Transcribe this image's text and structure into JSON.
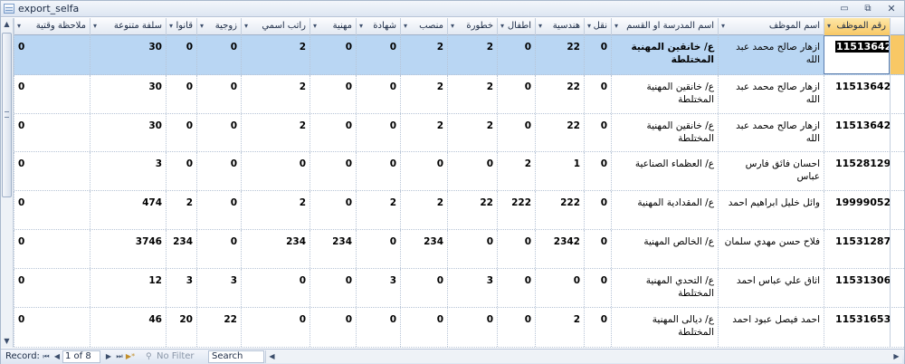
{
  "window": {
    "title": "export_selfa",
    "minimize_glyph": "▭",
    "restore_glyph": "⧉",
    "close_glyph": "✕"
  },
  "columns": [
    {
      "key": "notes",
      "label": "ملاحظة وقتية"
    },
    {
      "key": "advance",
      "label": "سلفة متنوعة"
    },
    {
      "key": "law",
      "label": "قانوا"
    },
    {
      "key": "spouse",
      "label": "زوجية"
    },
    {
      "key": "nominal_salary",
      "label": "راتب اسمي"
    },
    {
      "key": "professional",
      "label": "مهنية"
    },
    {
      "key": "certificate",
      "label": "شهادة"
    },
    {
      "key": "position",
      "label": "منصب"
    },
    {
      "key": "danger",
      "label": "خطورة"
    },
    {
      "key": "children",
      "label": "اطفال"
    },
    {
      "key": "engineering",
      "label": "هندسية"
    },
    {
      "key": "transport",
      "label": "نقل"
    },
    {
      "key": "school",
      "label": "اسم المدرسة او القسم"
    },
    {
      "key": "name",
      "label": "اسم الموظف"
    },
    {
      "key": "emp_id",
      "label": "رقم الموظف"
    }
  ],
  "rows": [
    {
      "emp_id": "115136427",
      "name": "ازهار صالح محمد عبد الله",
      "school": "ع/ خانقين المهنية المختلطة",
      "transport": "0",
      "engineering": "22",
      "children": "0",
      "danger": "2",
      "position": "2",
      "certificate": "0",
      "professional": "0",
      "nominal_salary": "2",
      "spouse": "0",
      "law": "0",
      "advance": "30",
      "notes": "0"
    },
    {
      "emp_id": "115136427",
      "name": "ازهار صالح محمد عبد الله",
      "school": "ع/ خانقين المهنية المختلطة",
      "transport": "0",
      "engineering": "22",
      "children": "0",
      "danger": "2",
      "position": "2",
      "certificate": "0",
      "professional": "0",
      "nominal_salary": "2",
      "spouse": "0",
      "law": "0",
      "advance": "30",
      "notes": "0"
    },
    {
      "emp_id": "115136427",
      "name": "ازهار صالح محمد عبد الله",
      "school": "ع/ خانقين المهنية المختلطة",
      "transport": "0",
      "engineering": "22",
      "children": "0",
      "danger": "2",
      "position": "2",
      "certificate": "0",
      "professional": "0",
      "nominal_salary": "2",
      "spouse": "0",
      "law": "0",
      "advance": "30",
      "notes": "0"
    },
    {
      "emp_id": "115281293",
      "name": "احسان فائق فارس عباس",
      "school": "ع/ العظماء الصناعية",
      "transport": "0",
      "engineering": "1",
      "children": "2",
      "danger": "0",
      "position": "0",
      "certificate": "0",
      "professional": "0",
      "nominal_salary": "0",
      "spouse": "0",
      "law": "0",
      "advance": "3",
      "notes": "0"
    },
    {
      "emp_id": "19999052",
      "name": "وائل خليل ابراهيم احمد",
      "school": "ع/ المقدادية المهنية",
      "transport": "0",
      "engineering": "222",
      "children": "222",
      "danger": "22",
      "position": "2",
      "certificate": "2",
      "professional": "0",
      "nominal_salary": "2",
      "spouse": "0",
      "law": "2",
      "advance": "474",
      "notes": "0"
    },
    {
      "emp_id": "115312874",
      "name": "فلاح حسن مهدي سلمان",
      "school": "ع/ الخالص المهنية",
      "transport": "0",
      "engineering": "2342",
      "children": "0",
      "danger": "0",
      "position": "234",
      "certificate": "0",
      "professional": "234",
      "nominal_salary": "234",
      "spouse": "0",
      "law": "234",
      "advance": "3746",
      "notes": "0"
    },
    {
      "emp_id": "115313062",
      "name": "اثاق علي عباس احمد",
      "school": "ع/ التحدي المهنية المختلطة",
      "transport": "0",
      "engineering": "0",
      "children": "0",
      "danger": "3",
      "position": "0",
      "certificate": "3",
      "professional": "0",
      "nominal_salary": "0",
      "spouse": "3",
      "law": "3",
      "advance": "12",
      "notes": "0"
    },
    {
      "emp_id": "115316537",
      "name": "احمد فيصل عبود احمد",
      "school": "ع/ ديالى المهنية المختلطة",
      "transport": "0",
      "engineering": "2",
      "children": "0",
      "danger": "0",
      "position": "0",
      "certificate": "0",
      "professional": "0",
      "nominal_salary": "0",
      "spouse": "22",
      "law": "20",
      "advance": "46",
      "notes": "0"
    }
  ],
  "selected_row": 0,
  "status": {
    "record_label": "Record:",
    "record_position": "1 of 8",
    "filter_label": "No Filter",
    "search_placeholder": "Search",
    "nav_first": "⏮",
    "nav_prev": "◀",
    "nav_next": "▶",
    "nav_last": "⏭",
    "nav_new": "▶*"
  },
  "scroll": {
    "up": "▲",
    "down": "▼",
    "left": "◀",
    "right": "▶"
  },
  "colors": {
    "selected_row": "#b9d6f3",
    "active_header": "#f8c865",
    "grid_line": "#b7c4d6"
  }
}
